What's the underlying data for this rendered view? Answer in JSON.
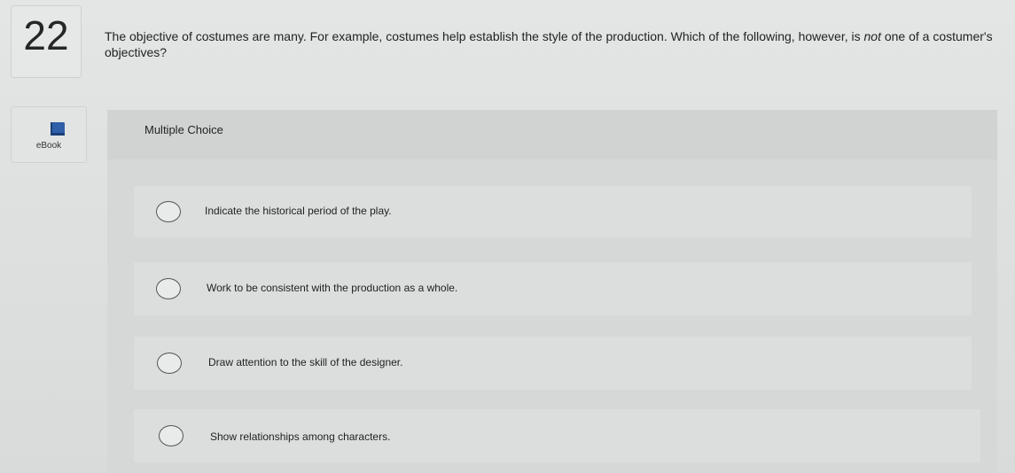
{
  "question": {
    "number": "22",
    "text_before_em": "The objective of costumes are many. For example, costumes help establish the style of the production. Which of the following, however, is ",
    "em": "not",
    "text_after_em": " one of a costumer's objectives?"
  },
  "ebook": {
    "label": "eBook",
    "icon": "book-icon"
  },
  "answer": {
    "type_label": "Multiple Choice",
    "options": [
      {
        "label": "Indicate the historical period of the play."
      },
      {
        "label": "Work to be consistent with the production as a whole."
      },
      {
        "label": "Draw attention to the skill of the designer."
      },
      {
        "label": "Show relationships among characters."
      }
    ]
  },
  "colors": {
    "accent": "#2f5fa8",
    "background": "#e0e2e2"
  }
}
